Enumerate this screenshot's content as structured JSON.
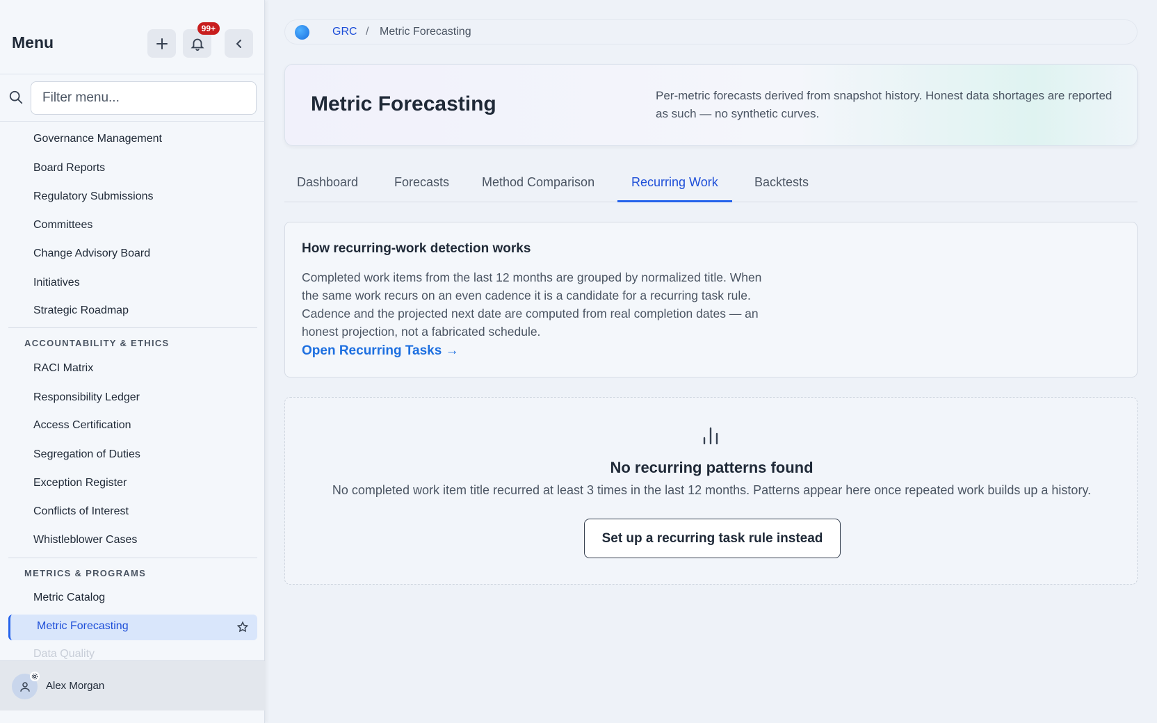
{
  "sidebar": {
    "title": "Menu",
    "notifications_badge": "99+",
    "search_placeholder": "Filter menu...",
    "items_top": [
      "Governance Management",
      "Board Reports",
      "Regulatory Submissions",
      "Committees",
      "Change Advisory Board",
      "Initiatives",
      "Strategic Roadmap"
    ],
    "section_accountability": "ACCOUNTABILITY & ETHICS",
    "items_accountability": [
      "RACI Matrix",
      "Responsibility Ledger",
      "Access Certification",
      "Segregation of Duties",
      "Exception Register",
      "Conflicts of Interest",
      "Whistleblower Cases"
    ],
    "section_metrics": "METRICS & PROGRAMS",
    "items_metrics": [
      "Metric Catalog"
    ],
    "active_item": "Metric Forecasting",
    "faded_item": "Data Quality",
    "user_name": "Alex Morgan"
  },
  "breadcrumb": {
    "root": "GRC",
    "separator": "/",
    "current": "Metric Forecasting"
  },
  "hero": {
    "title": "Metric Forecasting",
    "description": "Per-metric forecasts derived from snapshot history. Honest data shortages are reported as such — no synthetic curves."
  },
  "tabs": [
    "Dashboard",
    "Forecasts",
    "Method Comparison",
    "Recurring Work",
    "Backtests"
  ],
  "active_tab": "Recurring Work",
  "info_card": {
    "title": "How recurring-work detection works",
    "body": "Completed work items from the last 12 months are grouped by normalized title. When the same work recurs on an even cadence it is a candidate for a recurring task rule. Cadence and the projected next date are computed from real completion dates — an honest projection, not a fabricated schedule.",
    "link": "Open Recurring Tasks →"
  },
  "empty_state": {
    "title": "No recurring patterns found",
    "body": "No completed work item title recurred at least 3 times in the last 12 months. Patterns appear here once repeated work builds up a history.",
    "button": "Set up a recurring task rule instead"
  },
  "colors": {
    "accent": "#2563eb",
    "badge": "#c81e1e"
  }
}
